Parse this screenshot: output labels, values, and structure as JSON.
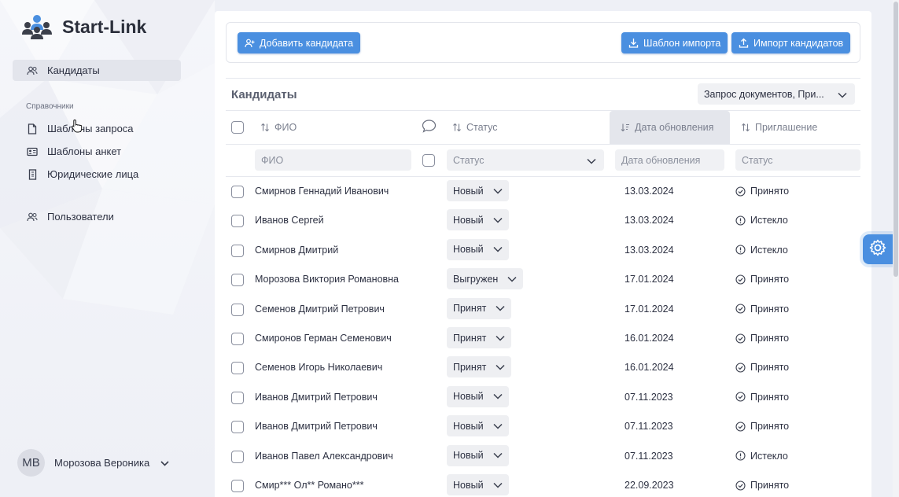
{
  "app": {
    "name": "Start-Link",
    "brand_color": "#4a8fe0"
  },
  "sidebar": {
    "items": [
      {
        "label": "Кандидаты",
        "icon": "users-icon",
        "active": true
      },
      {
        "label": "Шаблоны запроса",
        "icon": "document-icon"
      },
      {
        "label": "Шаблоны анкет",
        "icon": "id-card-icon"
      },
      {
        "label": "Юридические лица",
        "icon": "building-icon"
      },
      {
        "label": "Пользователи",
        "icon": "users-icon"
      }
    ],
    "section_label": "Справочники"
  },
  "user": {
    "initials": "МВ",
    "name": "Морозова Вероника"
  },
  "toolbar": {
    "add_label": "Добавить кандидата",
    "template_label": "Шаблон импорта",
    "import_label": "Импорт кандидатов"
  },
  "list": {
    "title": "Кандидаты",
    "filter_value": "Запрос документов, При...",
    "columns": {
      "name": "ФИО",
      "status": "Статус",
      "updated": "Дата обновления",
      "invite": "Приглашение"
    },
    "filters": {
      "name_placeholder": "ФИО",
      "status_placeholder": "Статус",
      "date_placeholder": "Дата обновления",
      "invite_placeholder": "Статус"
    },
    "rows": [
      {
        "name": "Смирнов Геннадий Иванович",
        "status": "Новый",
        "date": "13.03.2024",
        "invite": "Принято",
        "invite_icon": "check-circle-icon"
      },
      {
        "name": "Иванов Сергей",
        "status": "Новый",
        "date": "13.03.2024",
        "invite": "Истекло",
        "invite_icon": "alert-circle-icon"
      },
      {
        "name": "Смирнов Дмитрий",
        "status": "Новый",
        "date": "13.03.2024",
        "invite": "Истекло",
        "invite_icon": "alert-circle-icon"
      },
      {
        "name": "Морозова Виктория Романовна",
        "status": "Выгружен",
        "date": "17.01.2024",
        "invite": "Принято",
        "invite_icon": "check-circle-icon"
      },
      {
        "name": "Семенов Дмитрий Петрович",
        "status": "Принят",
        "date": "17.01.2024",
        "invite": "Принято",
        "invite_icon": "check-circle-icon"
      },
      {
        "name": "Смиронов Герман Семенович",
        "status": "Принят",
        "date": "16.01.2024",
        "invite": "Принято",
        "invite_icon": "check-circle-icon"
      },
      {
        "name": "Семенов Игорь Николаевич",
        "status": "Принят",
        "date": "16.01.2024",
        "invite": "Принято",
        "invite_icon": "check-circle-icon"
      },
      {
        "name": "Иванов Дмитрий Петрович",
        "status": "Новый",
        "date": "07.11.2023",
        "invite": "Принято",
        "invite_icon": "check-circle-icon"
      },
      {
        "name": "Иванов Дмитрий Петрович",
        "status": "Новый",
        "date": "07.11.2023",
        "invite": "Принято",
        "invite_icon": "check-circle-icon"
      },
      {
        "name": "Иванов Павел Александрович",
        "status": "Новый",
        "date": "07.11.2023",
        "invite": "Истекло",
        "invite_icon": "alert-circle-icon"
      },
      {
        "name": "Смир*** Ол** Романо***",
        "status": "Новый",
        "date": "22.09.2023",
        "invite": "Принято",
        "invite_icon": "check-circle-icon"
      }
    ]
  }
}
